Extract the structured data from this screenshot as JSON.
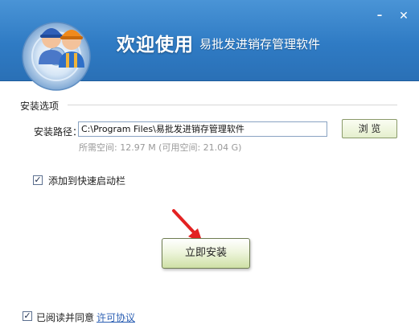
{
  "header": {
    "title_main": "欢迎使用",
    "title_sub": "易批发进销存管理软件",
    "minimize_glyph": "–",
    "close_glyph": "✕",
    "logo_icon": "cd-with-two-workers-icon",
    "colors": {
      "header_bg": "#3a86cd",
      "title_text": "#ffffff"
    }
  },
  "install_options": {
    "section_label": "安装选项",
    "path_label": "安装路径：",
    "path_value": "C:\\Program Files\\易批发进销存管理软件",
    "browse_label": "浏 览",
    "space_info": "所需空间: 12.97 M (可用空间: 21.04 G)"
  },
  "quick_launch": {
    "checked": true,
    "label": "添加到快速启动栏"
  },
  "install_button": {
    "label": "立即安装",
    "arrow_icon": "red-arrow-pointer-icon",
    "arrow_color": "#e32222"
  },
  "agreement": {
    "checked": true,
    "label": "已阅读并同意",
    "link_text": "许可协议",
    "link_color": "#2b5fb3"
  }
}
